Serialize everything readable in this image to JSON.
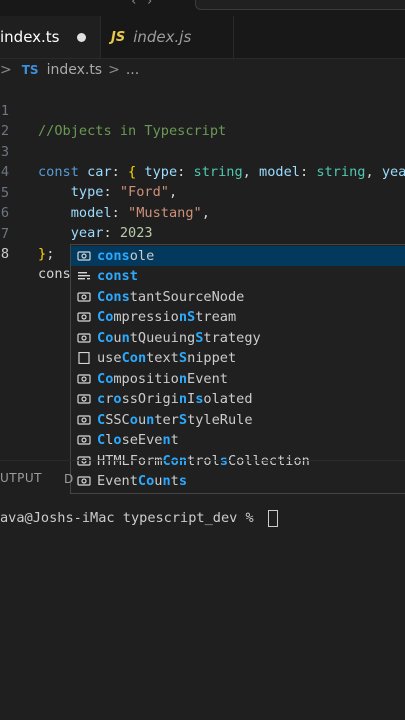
{
  "tabs": [
    {
      "label": "index.ts",
      "modified": true
    },
    {
      "icon": "JS",
      "label": "index.js"
    }
  ],
  "breadcrumb": {
    "prefix_chevron": ">",
    "icon": "TS",
    "file": "index.ts",
    "separator": ">",
    "rest": "..."
  },
  "editor": {
    "lines": [
      {
        "n": "1"
      },
      {
        "n": "2"
      },
      {
        "n": "3"
      },
      {
        "n": "4"
      },
      {
        "n": "5"
      },
      {
        "n": "6"
      },
      {
        "n": "7"
      },
      {
        "n": "8"
      }
    ],
    "line1": {
      "comment": "//Objects in Typescript"
    },
    "line3": {
      "kw": "const",
      "name": "car",
      "colon": ":",
      "open": "{",
      "k1": "type",
      "t1": "string",
      "k2": "model",
      "t2": "string",
      "k3": "year"
    },
    "line4": {
      "key": "type",
      "value": "\"Ford\""
    },
    "line5": {
      "key": "model",
      "value": "\"Mustang\""
    },
    "line6": {
      "key": "year",
      "value": "2023"
    },
    "line7": {
      "close": "}",
      "semi": ";"
    },
    "line8": {
      "typed": "cons"
    }
  },
  "suggestions": [
    {
      "icon": "symbol-variable",
      "match": "cons",
      "rest": "ole",
      "pre": ""
    },
    {
      "icon": "symbol-keyword",
      "match": "const",
      "rest": "",
      "pre": ""
    },
    {
      "icon": "symbol-variable",
      "label": "ConstantSourceNode"
    },
    {
      "icon": "symbol-variable",
      "label": "CompressionStream"
    },
    {
      "icon": "symbol-variable",
      "label": "CountQueuingStrategy"
    },
    {
      "icon": "symbol-snippet",
      "label": "useContextSnippet"
    },
    {
      "icon": "symbol-variable",
      "label": "CompositionEvent"
    },
    {
      "icon": "symbol-variable",
      "label": "crossOriginIsolated"
    },
    {
      "icon": "symbol-variable",
      "label": "CSSCounterStyleRule"
    },
    {
      "icon": "symbol-variable",
      "label": "CloseEvent"
    },
    {
      "icon": "symbol-variable",
      "label": "HTMLFormControlsCollection"
    },
    {
      "icon": "symbol-variable",
      "label": "EventCounts"
    }
  ],
  "panel": {
    "output_tab": "UTPUT",
    "second_tab": "D"
  },
  "terminal": {
    "prompt": "ava@Joshs-iMac typescript_dev % "
  }
}
